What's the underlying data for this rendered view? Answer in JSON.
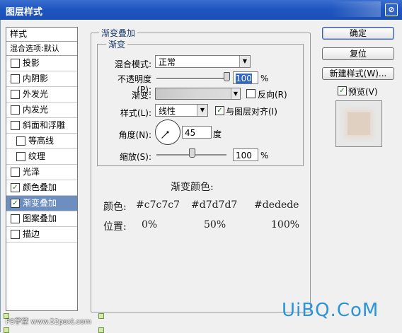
{
  "window": {
    "title": "图层样式"
  },
  "left_panel": {
    "header": "样式",
    "blend_options": "混合选项:默认",
    "items": [
      {
        "label": "投影",
        "checked": false,
        "sub": false,
        "selected": false
      },
      {
        "label": "内阴影",
        "checked": false,
        "sub": false,
        "selected": false
      },
      {
        "label": "外发光",
        "checked": false,
        "sub": false,
        "selected": false
      },
      {
        "label": "内发光",
        "checked": false,
        "sub": false,
        "selected": false
      },
      {
        "label": "斜面和浮雕",
        "checked": false,
        "sub": false,
        "selected": false
      },
      {
        "label": "等高线",
        "checked": false,
        "sub": true,
        "selected": false
      },
      {
        "label": "纹理",
        "checked": false,
        "sub": true,
        "selected": false
      },
      {
        "label": "光泽",
        "checked": false,
        "sub": false,
        "selected": false
      },
      {
        "label": "颜色叠加",
        "checked": true,
        "sub": false,
        "selected": false
      },
      {
        "label": "渐变叠加",
        "checked": true,
        "sub": false,
        "selected": true
      },
      {
        "label": "图案叠加",
        "checked": false,
        "sub": false,
        "selected": false
      },
      {
        "label": "描边",
        "checked": false,
        "sub": false,
        "selected": false
      }
    ]
  },
  "gradient_overlay": {
    "group_title": "渐变叠加",
    "sub_title": "渐变",
    "blend_mode_label": "混合模式:",
    "blend_mode_value": "正常",
    "opacity_label": "不透明度(P):",
    "opacity_value": "100",
    "opacity_level": 1.0,
    "percent": "%",
    "gradient_label": "渐变:",
    "reverse_label": "反向(R)",
    "reverse_checked": false,
    "style_label": "样式(L):",
    "style_value": "线性",
    "align_label": "与图层对齐(I)",
    "align_checked": true,
    "angle_label": "角度(N):",
    "angle_value": "45",
    "degree": "度",
    "scale_label": "缩放(S):",
    "scale_value": "100",
    "scale_level": 0.5
  },
  "notes": {
    "title": "渐变颜色:",
    "color_label": "颜色:",
    "colors": [
      "#c7c7c7",
      "#d7d7d7",
      "#dedede"
    ],
    "position_label": "位置:",
    "positions": [
      "0%",
      "50%",
      "100%"
    ]
  },
  "buttons": {
    "ok": "确定",
    "reset": "复位",
    "new_style": "新建样式(W)...",
    "preview_label": "预览(V)",
    "preview_checked": true
  },
  "watermarks": {
    "left": "PS学堂 www.52psxt.com",
    "right": "UiBQ.CoM"
  }
}
